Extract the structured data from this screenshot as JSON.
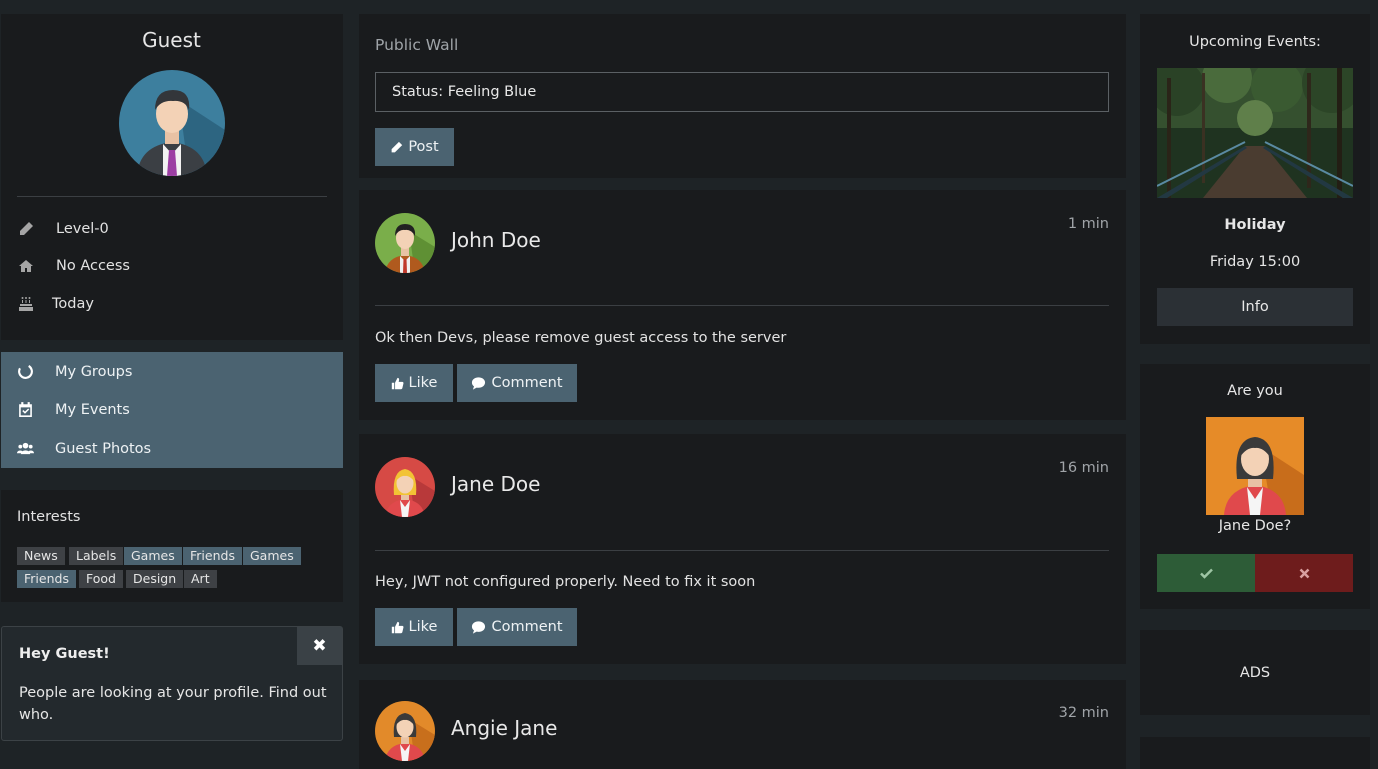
{
  "profile": {
    "name": "Guest"
  },
  "stats": [
    {
      "icon": "pencil-icon",
      "label": "Level-0"
    },
    {
      "icon": "home-icon",
      "label": "No Access"
    },
    {
      "icon": "birthday-cake-icon",
      "label": "Today"
    }
  ],
  "menu": [
    {
      "icon": "circle-notch-icon",
      "label": "My Groups"
    },
    {
      "icon": "calendar-check-icon",
      "label": "My Events"
    },
    {
      "icon": "users-icon",
      "label": "Guest Photos"
    }
  ],
  "interests": {
    "title": "Interests",
    "tags": [
      "News",
      "Labels",
      "Games",
      "Friends",
      "Games",
      "Friends",
      "Food",
      "Design",
      "Art"
    ]
  },
  "notice": {
    "title": "Hey Guest!",
    "body": "People are looking at your profile. Find out who.",
    "close": "✖"
  },
  "wall": {
    "title": "Public Wall",
    "status_value": "Status: Feeling Blue",
    "post_label": "Post"
  },
  "posts": [
    {
      "author": "John Doe",
      "time": "1 min",
      "text": "Ok then Devs, please remove guest access to the server",
      "like": "Like",
      "comment": "Comment"
    },
    {
      "author": "Jane Doe",
      "time": "16 min",
      "text": "Hey, JWT not configured properly. Need to fix it soon",
      "like": "Like",
      "comment": "Comment"
    },
    {
      "author": "Angie Jane",
      "time": "32 min"
    }
  ],
  "events": {
    "title": "Upcoming Events:",
    "name": "Holiday",
    "when": "Friday 15:00",
    "info": "Info"
  },
  "friend_request": {
    "title": "Are you",
    "name": "Jane Doe?",
    "accept_icon": "check-icon",
    "decline_icon": "close-icon"
  },
  "ads": {
    "label": "ADS"
  },
  "colors": {
    "accent": "#4b6371",
    "card": "#191b1d",
    "accept": "#2d5c37",
    "decline": "#6e1c1c"
  }
}
